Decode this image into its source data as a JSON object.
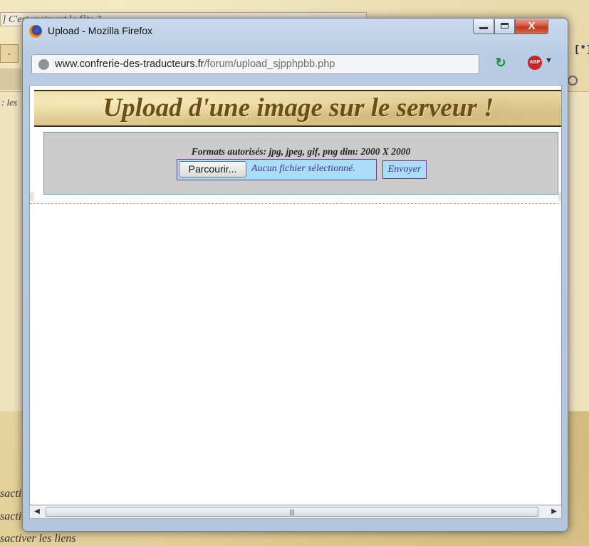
{
  "background": {
    "tab_title": "] C'est vraiment la fête ?",
    "left_button": "-",
    "left_text": ": les",
    "right_tag": "[*]",
    "links": [
      "sactiv",
      "sactiv",
      "sactiver les liens"
    ]
  },
  "window": {
    "title": "Upload - Mozilla Firefox",
    "min_label": "",
    "max_label": "",
    "close_label": "X"
  },
  "urlbar": {
    "domain": "www.confrerie-des-traducteurs.fr",
    "path": "/forum/upload_sjpphpbb.php"
  },
  "icons": {
    "abp_label": "ABP",
    "abp_dropdown": "▼"
  },
  "page": {
    "banner_title": "Upload d'une image sur le serveur !",
    "formats_text": "Formats autorisés: jpg, jpeg, gif, png dim: 2000 X 2000",
    "browse_label": "Parcourir...",
    "file_status": "Aucun fichier sélectionné.",
    "send_label": "Envoyer"
  },
  "scrollbar": {
    "left_arrow": "◀",
    "right_arrow": "▶",
    "grip": "|||"
  }
}
